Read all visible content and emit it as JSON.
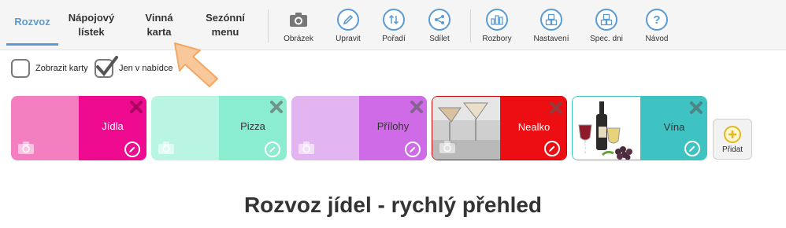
{
  "nav": {
    "tabs": [
      {
        "label": "Rozvoz",
        "active": true
      },
      {
        "label": "Nápojový lístek",
        "active": false
      },
      {
        "label": "Vinná karta",
        "active": false
      },
      {
        "label": "Sezónní menu",
        "active": false
      }
    ],
    "tools": [
      {
        "label": "Obrázek",
        "icon": "camera-icon"
      },
      {
        "label": "Upravit",
        "icon": "pencil-icon"
      },
      {
        "label": "Pořadí",
        "icon": "reorder-icon"
      },
      {
        "label": "Sdílet",
        "icon": "share-icon"
      },
      {
        "label": "Rozbory",
        "icon": "chart-icon"
      },
      {
        "label": "Nastavení",
        "icon": "settings-boxes-icon"
      },
      {
        "label": "Spec. dni",
        "icon": "special-days-icon"
      },
      {
        "label": "Návod",
        "icon": "help-icon"
      }
    ]
  },
  "options": {
    "show_cards": {
      "label": "Zobrazit karty",
      "checked": false
    },
    "only_offered": {
      "label": "Jen v nabídce",
      "checked": true
    }
  },
  "cards": [
    {
      "name": "Jídla",
      "color_left": "#f37fc1",
      "color_right": "#ee0b8f",
      "text_color": "#ffffff",
      "has_image": false,
      "image": ""
    },
    {
      "name": "Pizza",
      "color_left": "#baf5e3",
      "color_right": "#8aedcf",
      "text_color": "#333333",
      "has_image": false,
      "image": ""
    },
    {
      "name": "Přílohy",
      "color_left": "#e2b5f0",
      "color_right": "#cf6be6",
      "text_color": "#333333",
      "has_image": false,
      "image": ""
    },
    {
      "name": "Nealko",
      "color_left": "#cccccc",
      "color_right": "#ec0e13",
      "text_color": "#ffffff",
      "has_image": true,
      "image": "cocktail-glass-image"
    },
    {
      "name": "Vína",
      "color_left": "#ffffff",
      "color_right": "#3ec2c2",
      "text_color": "#333333",
      "has_image": true,
      "image": "wine-bottle-grapes-image"
    }
  ],
  "add_button": {
    "label": "Přidat",
    "icon": "plus-icon"
  },
  "heading": "Rozvoz jídel - rychlý přehled",
  "colors": {
    "accent": "#5a9bd4",
    "arrow": "#f8c89a",
    "add_icon": "#e3b720"
  }
}
